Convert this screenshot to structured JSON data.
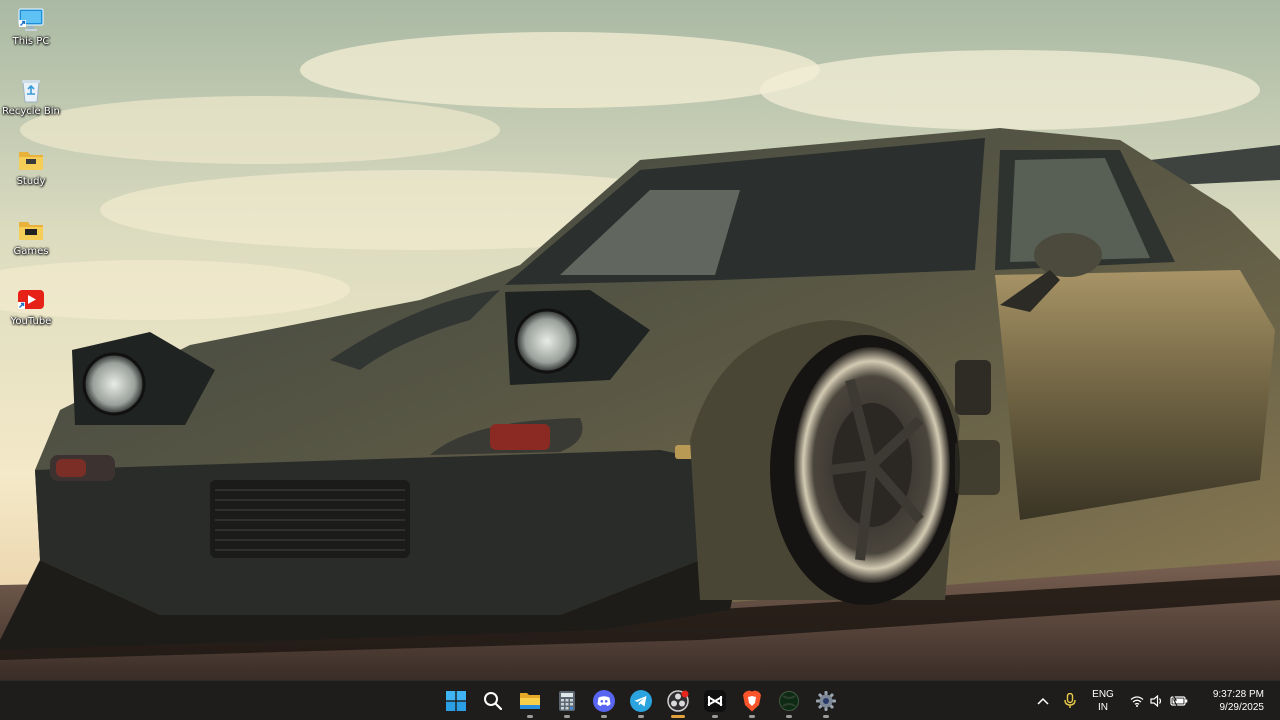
{
  "desktop": {
    "icons": [
      {
        "label": "This PC",
        "icon": "this-pc-icon"
      },
      {
        "label": "Recycle Bin",
        "icon": "recycle-bin-icon"
      },
      {
        "label": "Study",
        "icon": "folder-icon"
      },
      {
        "label": "Games",
        "icon": "folder-icon"
      },
      {
        "label": "YouTube",
        "icon": "youtube-shortcut-icon"
      }
    ]
  },
  "taskbar": {
    "apps": [
      {
        "name": "start",
        "icon": "windows-start-icon"
      },
      {
        "name": "search",
        "icon": "search-icon"
      },
      {
        "name": "file-explorer",
        "icon": "file-explorer-icon",
        "running": true
      },
      {
        "name": "calculator",
        "icon": "calculator-icon",
        "running": true
      },
      {
        "name": "discord",
        "icon": "discord-icon",
        "running": true
      },
      {
        "name": "telegram",
        "icon": "telegram-icon",
        "running": true
      },
      {
        "name": "obs",
        "icon": "obs-recording-icon",
        "running": true,
        "active": true
      },
      {
        "name": "capcut",
        "icon": "capcut-icon",
        "running": true
      },
      {
        "name": "brave",
        "icon": "brave-browser-icon",
        "running": true
      },
      {
        "name": "xbox",
        "icon": "xbox-icon",
        "running": true
      },
      {
        "name": "settings",
        "icon": "settings-gear-icon",
        "running": true
      }
    ],
    "tray": {
      "language_line1": "ENG",
      "language_line2": "IN",
      "time": "9:37:28 PM",
      "date": "9/29/2025"
    }
  },
  "colors": {
    "taskbar_bg": "#1f1d1c",
    "active_indicator": "#e2a13b",
    "folder_yellow": "#f3c444",
    "youtube_red": "#e62117"
  }
}
